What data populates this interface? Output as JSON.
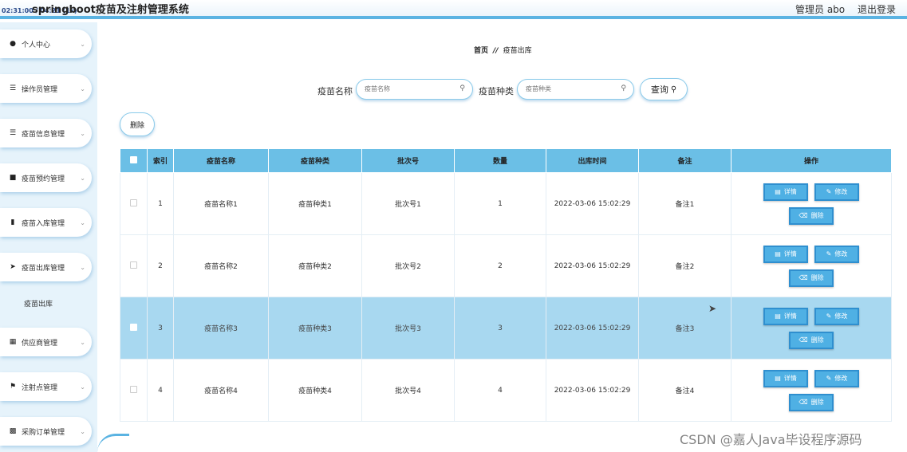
{
  "header": {
    "title": "springboot疫苗及注射管理系统",
    "stamp": "02:31:00 / 04:21 (1x)",
    "user_label": "管理员 abo",
    "logout_label": "退出登录"
  },
  "sidebar": {
    "items": [
      {
        "label": "个人中心",
        "icon": "person-icon"
      },
      {
        "label": "操作员管理",
        "icon": "list-icon"
      },
      {
        "label": "疫苗信息管理",
        "icon": "list-icon"
      },
      {
        "label": "疫苗预约管理",
        "icon": "briefcase-icon"
      },
      {
        "label": "疫苗入库管理",
        "icon": "box-icon"
      },
      {
        "label": "疫苗出库管理",
        "icon": "send-icon"
      },
      {
        "label": "供应商管理",
        "icon": "grid-icon"
      },
      {
        "label": "注射点管理",
        "icon": "flag-icon"
      },
      {
        "label": "采购订单管理",
        "icon": "document-icon"
      }
    ],
    "submenu_label": "疫苗出库"
  },
  "breadcrumb": {
    "home": "首页",
    "separator": "//",
    "current": "疫苗出库"
  },
  "search": {
    "name_label": "疫苗名称",
    "name_placeholder": "疫苗名称",
    "type_label": "疫苗种类",
    "type_placeholder": "疫苗种类",
    "query_label": "查询"
  },
  "toolbar": {
    "delete_label": "删除"
  },
  "table": {
    "columns": [
      "索引",
      "疫苗名称",
      "疫苗种类",
      "批次号",
      "数量",
      "出库时间",
      "备注",
      "操作"
    ],
    "rows": [
      {
        "index": "1",
        "name": "疫苗名称1",
        "type": "疫苗种类1",
        "batch": "批次号1",
        "qty": "1",
        "time": "2022-03-06 15:02:29",
        "note": "备注1"
      },
      {
        "index": "2",
        "name": "疫苗名称2",
        "type": "疫苗种类2",
        "batch": "批次号2",
        "qty": "2",
        "time": "2022-03-06 15:02:29",
        "note": "备注2"
      },
      {
        "index": "3",
        "name": "疫苗名称3",
        "type": "疫苗种类3",
        "batch": "批次号3",
        "qty": "3",
        "time": "2022-03-06 15:02:29",
        "note": "备注3"
      },
      {
        "index": "4",
        "name": "疫苗名称4",
        "type": "疫苗种类4",
        "batch": "批次号4",
        "qty": "4",
        "time": "2022-03-06 15:02:29",
        "note": "备注4"
      }
    ],
    "highlighted_row": 3,
    "actions": {
      "detail": "详情",
      "edit": "修改",
      "delete": "删除"
    }
  },
  "watermark": "CSDN @嘉人Java毕设程序源码",
  "colors": {
    "accent": "#5ab3e2",
    "header_row": "#6bbfe6",
    "button": "#4fb0e4",
    "highlight_row": "#a8d8f0"
  }
}
